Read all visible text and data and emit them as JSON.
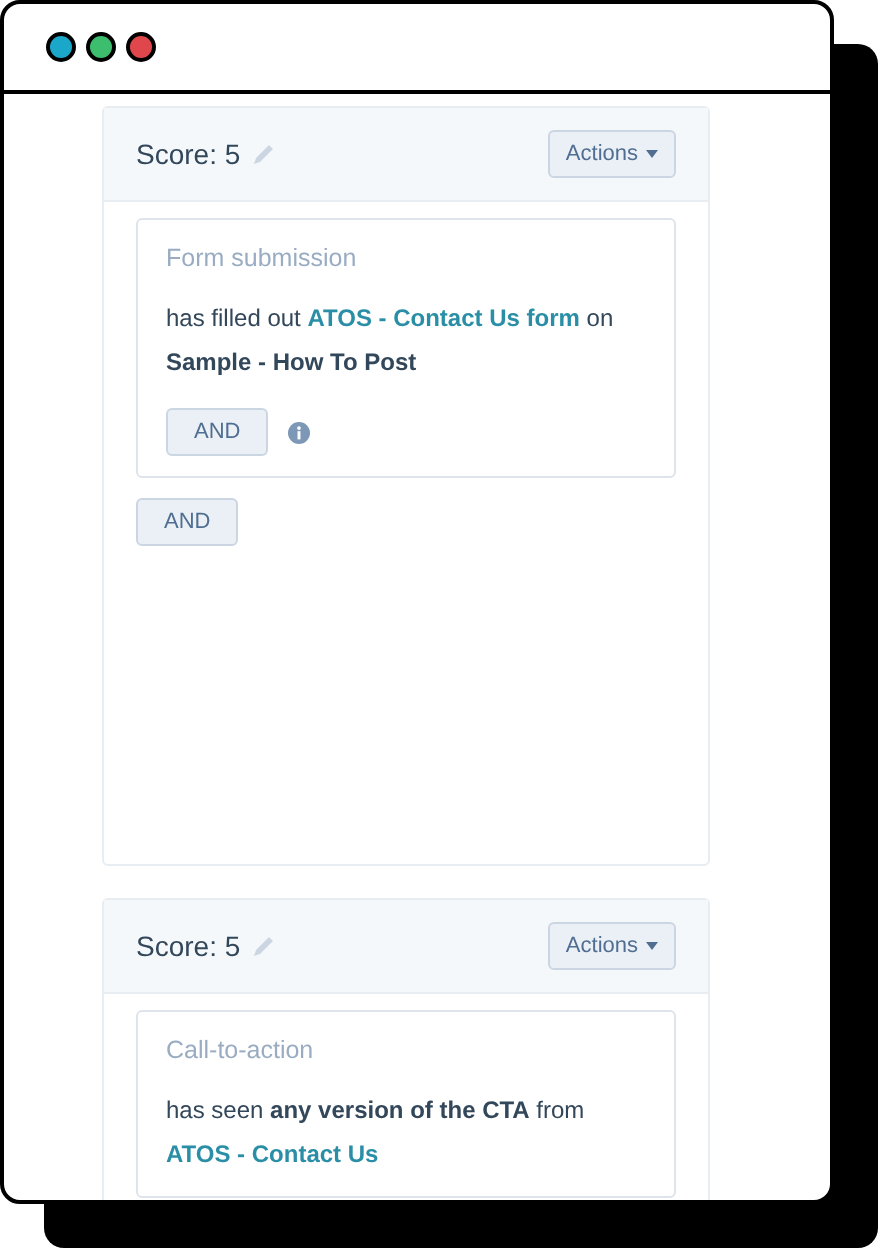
{
  "window": {
    "dots": [
      {
        "color": "#1aa7c9"
      },
      {
        "color": "#3dbd6e"
      },
      {
        "color": "#e0474c"
      }
    ]
  },
  "cards": [
    {
      "score": "Score: 5",
      "actions": "Actions",
      "tall": true,
      "criteria": [
        {
          "type": "Form submission",
          "description": [
            {
              "kind": "plain",
              "text": "has filled out "
            },
            {
              "kind": "link",
              "text": "ATOS - Contact Us form"
            },
            {
              "kind": "plain",
              "text": " on "
            },
            {
              "kind": "bold",
              "text": "Sample - How To Post"
            }
          ],
          "and_button": "AND",
          "info": true
        }
      ],
      "and_button": "AND"
    },
    {
      "score": "Score: 5",
      "actions": "Actions",
      "tall": false,
      "criteria": [
        {
          "type": "Call-to-action",
          "description": [
            {
              "kind": "plain",
              "text": "has seen "
            },
            {
              "kind": "bold",
              "text": "any version of the CTA"
            },
            {
              "kind": "plain",
              "text": " from "
            },
            {
              "kind": "link",
              "text": "ATOS - Contact Us"
            }
          ],
          "info": false
        }
      ]
    }
  ]
}
